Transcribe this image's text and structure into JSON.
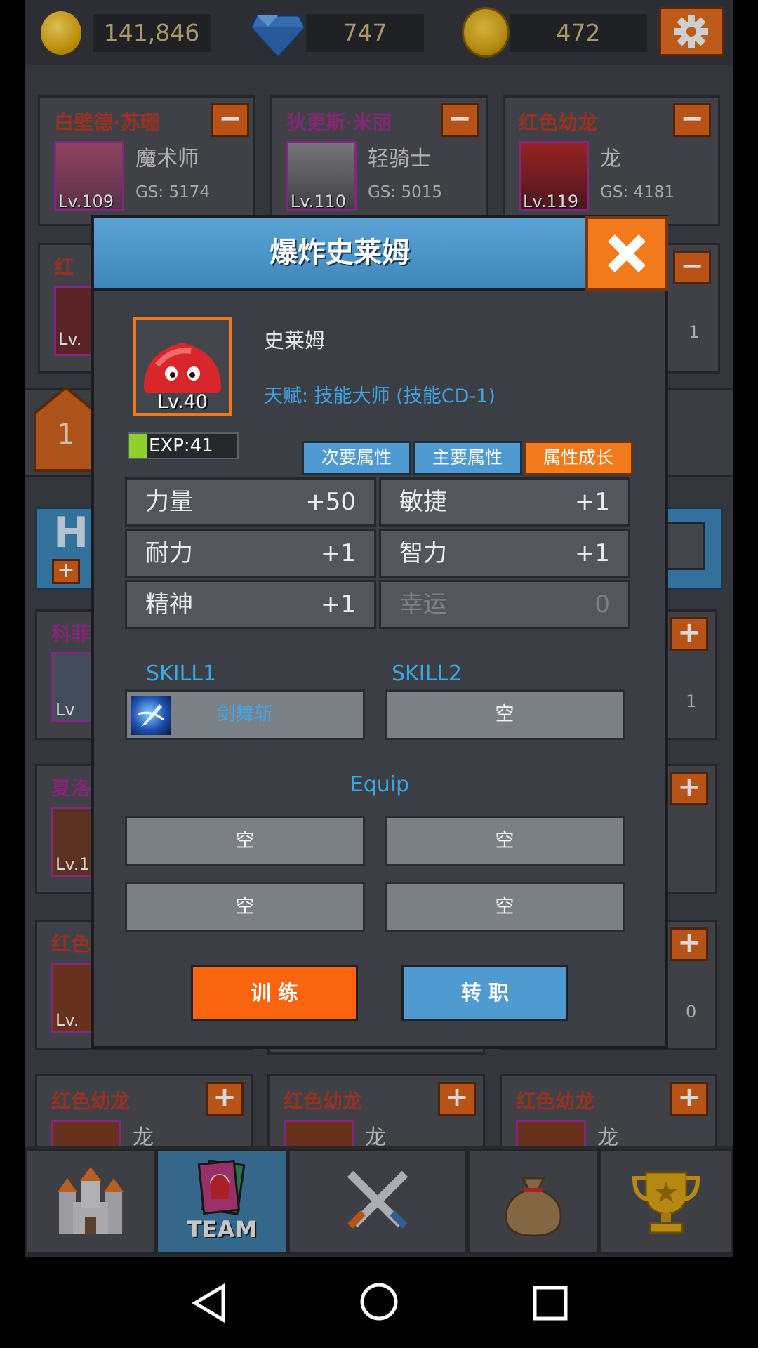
{
  "resources": {
    "gold": "141,846",
    "diamonds": "747",
    "medals": "472"
  },
  "team_cards": [
    {
      "name": "白壁德·苏珊",
      "class": "魔术师",
      "gs": "GS: 5174",
      "level": "Lv.109"
    },
    {
      "name": "狄更斯·米丽",
      "class": "轻骑士",
      "gs": "GS: 5015",
      "level": "Lv.110"
    },
    {
      "name": "红色幼龙",
      "class": "龙",
      "gs": "GS: 4181",
      "level": "Lv.119"
    }
  ],
  "side_fragments": {
    "row2_left_name": "红",
    "row2_left_level": "Lv.",
    "row2_right_num": "1",
    "hero_banner": "HI",
    "ribbon_number": "1",
    "row3_left_name": "科菲",
    "row3_left_level": "Lv",
    "row3_right_num": "1",
    "row4_left_name": "夏洛",
    "row4_left_level": "Lv.1",
    "row5_left_name": "红色",
    "row5_left_level": "Lv.",
    "row5_right_num": "0"
  },
  "bottom_cards": [
    {
      "name": "红色幼龙",
      "class": "龙"
    },
    {
      "name": "红色幼龙",
      "class": "龙"
    },
    {
      "name": "红色幼龙",
      "class": "龙"
    }
  ],
  "dialog": {
    "title": "爆炸史莱姆",
    "monster_name": "史莱姆",
    "monster_level": "Lv.40",
    "talent": "天赋: 技能大师 (技能CD-1)",
    "exp_label": "EXP:41",
    "tabs": [
      {
        "label": "次要属性",
        "active": false
      },
      {
        "label": "主要属性",
        "active": false
      },
      {
        "label": "属性成长",
        "active": true
      }
    ],
    "stats": [
      {
        "label": "力量",
        "value": "+50"
      },
      {
        "label": "敏捷",
        "value": "+1"
      },
      {
        "label": "耐力",
        "value": "+1"
      },
      {
        "label": "智力",
        "value": "+1"
      },
      {
        "label": "精神",
        "value": "+1"
      },
      {
        "label": "幸运",
        "value": "0"
      }
    ],
    "skill1_label": "SKILL1",
    "skill2_label": "SKILL2",
    "skill1_name": "剑舞斩",
    "skill2_name": "空",
    "equip_label": "Equip",
    "equip_slots": [
      "空",
      "空",
      "空",
      "空"
    ],
    "train_button": "训 练",
    "job_button": "转 职"
  },
  "navbar": {
    "team_label": "TEAM"
  },
  "colors": {
    "accent_orange": "#f07a1c",
    "accent_blue": "#4e9ad1",
    "background": "#3b3e44",
    "text_blue": "#3fa2e3"
  }
}
